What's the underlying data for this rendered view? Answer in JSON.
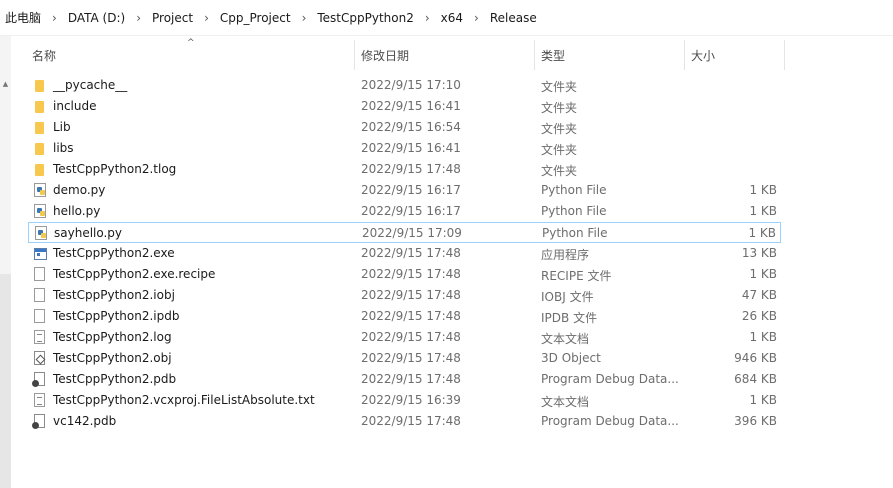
{
  "breadcrumb": {
    "items": [
      "此电脑",
      "DATA (D:)",
      "Project",
      "Cpp_Project",
      "TestCppPython2",
      "x64",
      "Release"
    ],
    "separator": "›"
  },
  "columns": {
    "name": "名称",
    "date": "修改日期",
    "type": "类型",
    "size": "大小",
    "sort_indicator": "^"
  },
  "files": [
    {
      "name": "__pycache__",
      "date": "2022/9/15 17:10",
      "type": "文件夹",
      "size": "",
      "icon": "folder-icon"
    },
    {
      "name": "include",
      "date": "2022/9/15 16:41",
      "type": "文件夹",
      "size": "",
      "icon": "folder-icon"
    },
    {
      "name": "Lib",
      "date": "2022/9/15 16:54",
      "type": "文件夹",
      "size": "",
      "icon": "folder-icon"
    },
    {
      "name": "libs",
      "date": "2022/9/15 16:41",
      "type": "文件夹",
      "size": "",
      "icon": "folder-icon"
    },
    {
      "name": "TestCppPython2.tlog",
      "date": "2022/9/15 17:48",
      "type": "文件夹",
      "size": "",
      "icon": "folder-icon"
    },
    {
      "name": "demo.py",
      "date": "2022/9/15 16:17",
      "type": "Python File",
      "size": "1 KB",
      "icon": "python-file-icon"
    },
    {
      "name": "hello.py",
      "date": "2022/9/15 16:17",
      "type": "Python File",
      "size": "1 KB",
      "icon": "python-file-icon"
    },
    {
      "name": "sayhello.py",
      "date": "2022/9/15 17:09",
      "type": "Python File",
      "size": "1 KB",
      "icon": "python-file-icon",
      "selected": true
    },
    {
      "name": "TestCppPython2.exe",
      "date": "2022/9/15 17:48",
      "type": "应用程序",
      "size": "13 KB",
      "icon": "application-icon"
    },
    {
      "name": "TestCppPython2.exe.recipe",
      "date": "2022/9/15 17:48",
      "type": "RECIPE 文件",
      "size": "1 KB",
      "icon": "blank-file-icon"
    },
    {
      "name": "TestCppPython2.iobj",
      "date": "2022/9/15 17:48",
      "type": "IOBJ 文件",
      "size": "47 KB",
      "icon": "blank-file-icon"
    },
    {
      "name": "TestCppPython2.ipdb",
      "date": "2022/9/15 17:48",
      "type": "IPDB 文件",
      "size": "26 KB",
      "icon": "blank-file-icon"
    },
    {
      "name": "TestCppPython2.log",
      "date": "2022/9/15 17:48",
      "type": "文本文档",
      "size": "1 KB",
      "icon": "text-file-icon"
    },
    {
      "name": "TestCppPython2.obj",
      "date": "2022/9/15 17:48",
      "type": "3D Object",
      "size": "946 KB",
      "icon": "3d-object-icon"
    },
    {
      "name": "TestCppPython2.pdb",
      "date": "2022/9/15 17:48",
      "type": "Program Debug Data...",
      "size": "684 KB",
      "icon": "debug-database-icon"
    },
    {
      "name": "TestCppPython2.vcxproj.FileListAbsolute.txt",
      "date": "2022/9/15 16:39",
      "type": "文本文档",
      "size": "1 KB",
      "icon": "text-file-icon"
    },
    {
      "name": "vc142.pdb",
      "date": "2022/9/15 17:48",
      "type": "Program Debug Data...",
      "size": "396 KB",
      "icon": "debug-database-icon"
    }
  ],
  "colors": {
    "selection_border": "#99d1ff",
    "folder": "#f8c84e",
    "secondary_text": "#6d6d6d"
  }
}
